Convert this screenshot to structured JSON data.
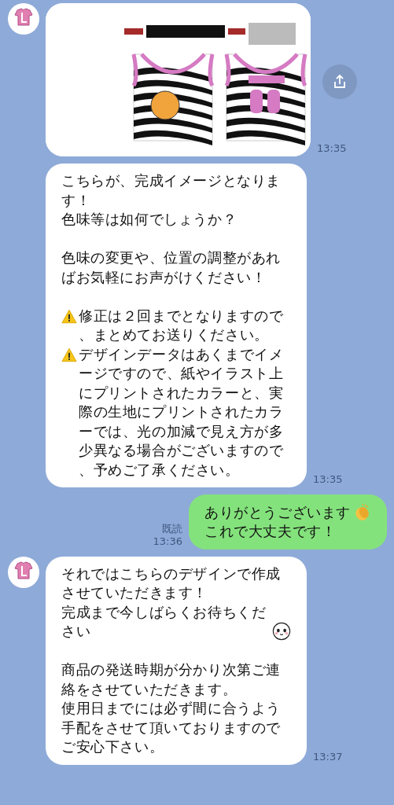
{
  "messages": [
    {
      "kind": "image",
      "avatar": true,
      "time": "13:35"
    },
    {
      "kind": "text",
      "avatar": false,
      "time": "13:35",
      "paragraphs": [
        {
          "kind": "plain",
          "text": "こちらが、完成イメージとなります！"
        },
        {
          "kind": "plain",
          "text": "色味等は如何でしょうか？"
        },
        {
          "kind": "gap"
        },
        {
          "kind": "plain",
          "text": "色味の変更や、位置の調整があればお気軽にお声がけください！"
        },
        {
          "kind": "gap"
        },
        {
          "kind": "warning",
          "text": "修正は２回までとなりますので、まとめてお送りください。"
        },
        {
          "kind": "warning",
          "text": "デザインデータはあくまでイメージですので、紙やイラスト上にプリントされたカラーと、実際の生地にプリントされたカラーでは、光の加減で見え方が多少異なる場合がございますので、予めご了承ください。"
        }
      ]
    },
    {
      "kind": "sent",
      "read": "既読",
      "time": "13:36",
      "paragraphs": [
        {
          "kind": "emoji_end",
          "text": "ありがとうございます"
        },
        {
          "kind": "plain",
          "text": "これで大丈夫です！"
        }
      ]
    },
    {
      "kind": "text",
      "avatar": true,
      "time": "13:37",
      "paragraphs": [
        {
          "kind": "plain",
          "text": "それではこちらのデザインで作成させていただきます！"
        },
        {
          "kind": "emoji_end",
          "text": "完成まで今しばらくお待ちください"
        },
        {
          "kind": "gap"
        },
        {
          "kind": "plain",
          "text": "商品の発送時期が分かり次第ご連絡をさせていただきます。"
        },
        {
          "kind": "plain",
          "text": "使用日までには必ず間に合うよう手配をさせて頂いておりますのでご安心下さい。"
        }
      ]
    }
  ]
}
